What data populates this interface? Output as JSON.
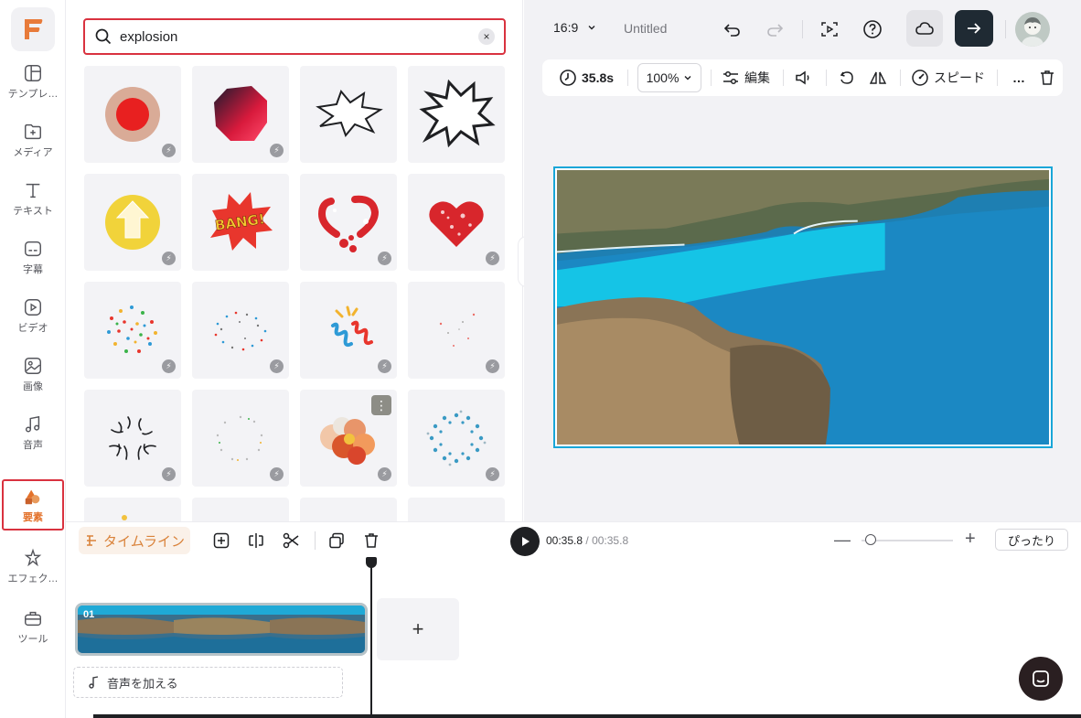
{
  "sidebar": {
    "items": [
      {
        "label": "テンプレ…",
        "icon": "template-icon"
      },
      {
        "label": "メディア",
        "icon": "media-folder-icon"
      },
      {
        "label": "テキスト",
        "icon": "text-icon"
      },
      {
        "label": "字幕",
        "icon": "subtitle-icon"
      },
      {
        "label": "ビデオ",
        "icon": "video-icon"
      },
      {
        "label": "画像",
        "icon": "image-icon"
      },
      {
        "label": "音声",
        "icon": "music-icon"
      },
      {
        "label": "要素",
        "icon": "elements-icon"
      },
      {
        "label": "エフェク…",
        "icon": "effects-icon"
      },
      {
        "label": "ツール",
        "icon": "toolbox-icon"
      }
    ],
    "active_index": 7
  },
  "search": {
    "value": "explosion",
    "clear_label": "×"
  },
  "results": [
    {
      "name": "red-circle-element"
    },
    {
      "name": "red-polygon-element"
    },
    {
      "name": "outline-burst-element"
    },
    {
      "name": "bold-burst-element"
    },
    {
      "name": "yellow-arrow-element"
    },
    {
      "name": "bang-element",
      "text": "BANG!"
    },
    {
      "name": "red-heart-splash-element"
    },
    {
      "name": "red-heart-pieces-element"
    },
    {
      "name": "confetti-color-element"
    },
    {
      "name": "confetti-small-element"
    },
    {
      "name": "spiral-confetti-element"
    },
    {
      "name": "sparse-particles-element"
    },
    {
      "name": "black-strokes-burst-element"
    },
    {
      "name": "dot-ring-element"
    },
    {
      "name": "balloons-element"
    },
    {
      "name": "blue-dot-burst-element"
    }
  ],
  "topbar": {
    "aspect_ratio": "16:9",
    "title": "Untitled"
  },
  "toolbar": {
    "duration": "35.8s",
    "zoom": "100%",
    "edit_label": "編集",
    "speed_label": "スピード",
    "more_label": "…"
  },
  "timeline": {
    "tab_label": "タイムライン",
    "current_time": "00:35.8",
    "separator": "/",
    "total_time": "00:35.8",
    "fit_label": "ぴったり",
    "clip_number": "01",
    "add_audio_label": "音声を加える"
  },
  "colors": {
    "accent_red": "#d9323f",
    "brand_orange": "#e3712a",
    "selection_blue": "#19a6d8"
  }
}
